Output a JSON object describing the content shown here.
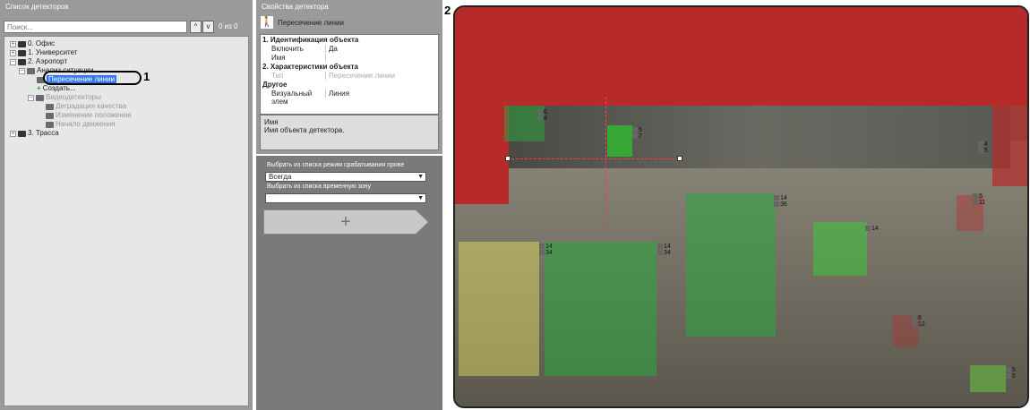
{
  "detector_list": {
    "title": "Список детекторов",
    "search_placeholder": "Поиск...",
    "count": "0 из 0",
    "tree": [
      {
        "label": "0. Офис"
      },
      {
        "label": "1. Университет"
      },
      {
        "label": "2. Аэропорт"
      },
      {
        "label": "Анализ ситуации"
      },
      {
        "label": "Пересечение линии"
      },
      {
        "label": "Создать..."
      },
      {
        "label": "Видеодетекторы"
      },
      {
        "label": "Деградация качества"
      },
      {
        "label": "Изменение положения"
      },
      {
        "label": "Начало движения"
      },
      {
        "label": "3. Трасса"
      }
    ]
  },
  "properties": {
    "title": "Свойства детектора",
    "detector_name": "Пересечение линии",
    "rows": [
      {
        "k": "1. Идентификация объекта",
        "v": ""
      },
      {
        "k": "Включить",
        "v": "Да"
      },
      {
        "k": "Имя",
        "v": ""
      },
      {
        "k": "2. Характеристики объекта",
        "v": ""
      },
      {
        "k": "Тип",
        "v": "Пересечение линии"
      },
      {
        "k": "Другое",
        "v": ""
      },
      {
        "k": "Визуальный элем",
        "v": "Линия"
      }
    ],
    "desc_title": "Имя",
    "desc_text": "Имя объекта детектора."
  },
  "triggers": {
    "mode_label": "Выбрать из списка режим срабатывания прове",
    "mode_value": "Всегда",
    "zone_label": "Выбрать из списка временную зону",
    "zone_value": "",
    "add_symbol": "+"
  },
  "video": {
    "badges": [
      [
        "6",
        "8"
      ],
      [
        "5",
        "7"
      ],
      [
        "4",
        "5"
      ],
      [
        "5",
        "11"
      ],
      [
        "14",
        "36"
      ],
      [
        "14",
        "34"
      ],
      [
        "14",
        "34"
      ],
      [
        "14",
        ""
      ],
      [
        "8",
        "12"
      ],
      [
        "5",
        "6"
      ]
    ]
  },
  "callouts": {
    "c1": "1",
    "c2": "2"
  }
}
